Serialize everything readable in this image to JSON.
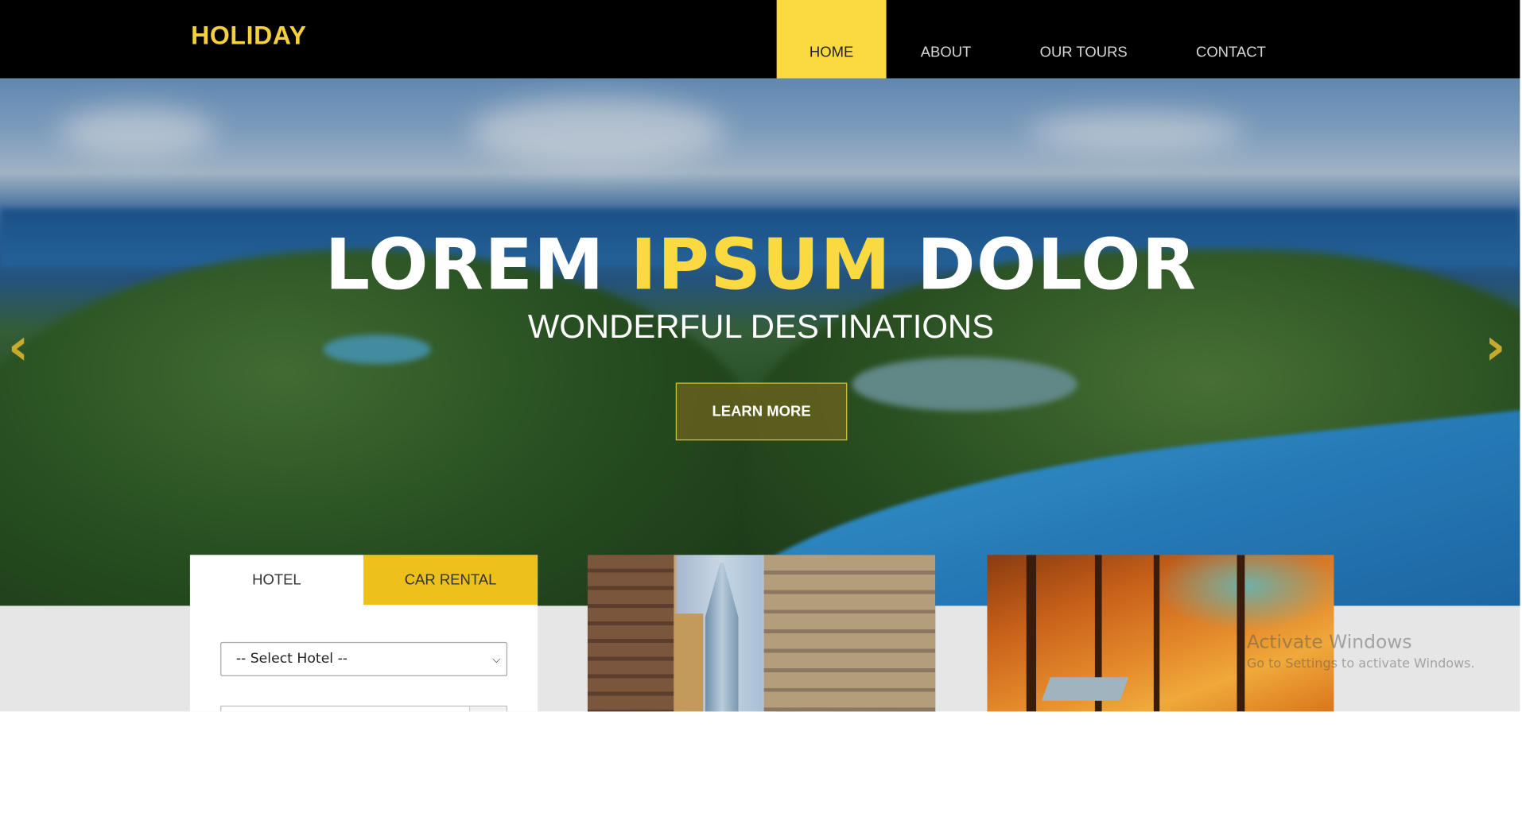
{
  "brand": {
    "name": "HOLIDAY"
  },
  "nav": {
    "items": [
      {
        "label": "HOME",
        "active": true
      },
      {
        "label": "ABOUT",
        "active": false
      },
      {
        "label": "OUR TOURS",
        "active": false
      },
      {
        "label": "CONTACT",
        "active": false
      }
    ]
  },
  "hero": {
    "headline_part1": "LOREM ",
    "headline_highlight": "IPSUM",
    "headline_part2": " DOLOR",
    "subline": "WONDERFUL DESTINATIONS",
    "cta_label": "LEARN MORE",
    "prev_icon": "chevron-left-icon",
    "next_icon": "chevron-right-icon"
  },
  "booking": {
    "tabs": [
      {
        "label": "HOTEL",
        "active": true
      },
      {
        "label": "CAR RENTAL",
        "active": false
      }
    ],
    "hotel_select_value": "-- Select Hotel --"
  },
  "watermark": {
    "title": "Activate Windows",
    "subtitle": "Go to Settings to activate Windows."
  },
  "colors": {
    "accent": "#fbd941",
    "brand_text": "#f5cf3d",
    "topbar_bg": "#000000",
    "tab_inactive_bg": "#edc01b",
    "band_bg": "#e6e6e6"
  }
}
